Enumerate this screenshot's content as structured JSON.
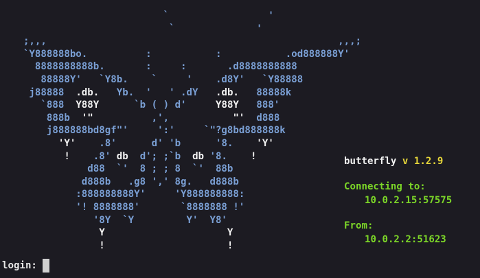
{
  "art": [
    [
      [
        "b",
        "                            `                 '"
      ]
    ],
    [
      [
        "b",
        "                             `              '"
      ]
    ],
    [
      [
        "b",
        "    ;,,,                                                  ,,,;"
      ]
    ],
    [
      [
        "b",
        "    `Y888888bo.          :           :           .od888888Y'"
      ]
    ],
    [
      [
        "b",
        "      8888888888b.       :     :       .d8888888888"
      ]
    ],
    [
      [
        "b",
        "       88888Y'   `Y8b.    `     '    .d8Y'   `Y88888"
      ]
    ],
    [
      [
        "b",
        "     j88888  "
      ],
      [
        "w",
        ".db."
      ],
      [
        "b",
        "   Yb.  '   ' .dY   "
      ],
      [
        "w",
        ".db."
      ],
      [
        "b",
        "   88888k"
      ]
    ],
    [
      [
        "b",
        "       `888  "
      ],
      [
        "w",
        "Y88Y"
      ],
      [
        "b",
        "      `b ( ) d'     "
      ],
      [
        "w",
        "Y88Y"
      ],
      [
        "b",
        "   888'"
      ]
    ],
    [
      [
        "b",
        "        888b  "
      ],
      [
        "w",
        "'\""
      ],
      [
        "b",
        "          ,',           "
      ],
      [
        "w",
        "\"'"
      ],
      [
        "b",
        "  d888"
      ]
    ],
    [
      [
        "b",
        "        j888888bd8gf\"'     ':'     `\"?g8bd888888k"
      ]
    ],
    [
      [
        "b",
        "          "
      ],
      [
        "w",
        "'Y'"
      ],
      [
        "b",
        "    .8'      d' 'b      '8.    "
      ],
      [
        "w",
        "'Y'"
      ]
    ],
    [
      [
        "b",
        "           "
      ],
      [
        "w",
        "!"
      ],
      [
        "b",
        "    .8' "
      ],
      [
        "w",
        "db"
      ],
      [
        "b",
        "  d'; ;`b  "
      ],
      [
        "w",
        "db"
      ],
      [
        "b",
        " '8.    "
      ],
      [
        "w",
        "!"
      ]
    ],
    [
      [
        "b",
        "               d88  `'  8 ; ; 8  `'  88b"
      ]
    ],
    [
      [
        "b",
        "              d888b   .g8 ',' 8g.   d888b"
      ]
    ],
    [
      [
        "b",
        "             :888888888Y'     'Y888888888:"
      ]
    ],
    [
      [
        "b",
        "             '! 8888888'       `8888888 !'"
      ]
    ],
    [
      [
        "b",
        "                '8Y  `Y         Y'  Y8'"
      ]
    ],
    [
      [
        "w",
        "                 Y                     Y"
      ]
    ],
    [
      [
        "w",
        "                 !                     !"
      ]
    ]
  ],
  "info": {
    "name": "butterfly",
    "version_prefix": "v",
    "version": "1.2.9",
    "connecting_label": "Connecting to:",
    "connecting_value": "10.0.2.15:57575",
    "from_label": "From:",
    "from_value": "10.0.2.2:51623"
  },
  "prompt": {
    "label": "login:"
  },
  "colors": {
    "background": "#1c1b22",
    "art_blue": "#7a9fd4",
    "art_white": "#f2f2f2",
    "version_yellow": "#e6d63a",
    "status_green": "#7cd628"
  }
}
